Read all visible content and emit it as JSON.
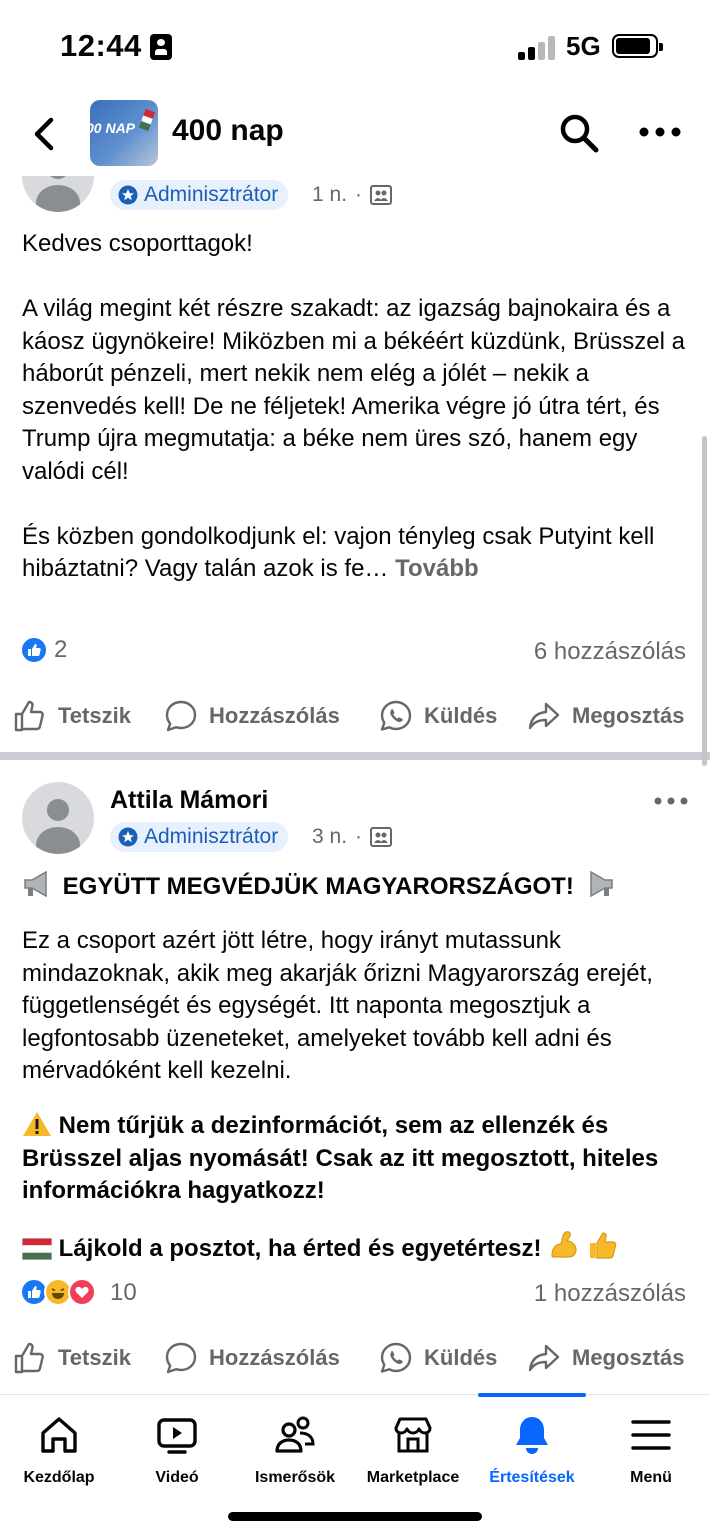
{
  "status_bar": {
    "time": "12:44",
    "network": "5G"
  },
  "header": {
    "group_name": "400 nap",
    "avatar_text": "00 NAP"
  },
  "post1": {
    "badge": "Adminisztrátor",
    "time": "1 n.",
    "dot": "·",
    "paragraphs": [
      "Kedves csoporttagok!",
      "A világ megint két részre szakadt: az igazság bajnokaira és a káosz ügynökeire! Miközben mi a békéért küzdünk, Brüsszel a háborút pénzeli, mert nekik nem elég a jólét – nekik a szenvedés kell! De ne féljetek! Amerika végre jó útra tért, és Trump újra megmutatja: a béke nem üres szó, hanem egy valódi cél!",
      "És közben gondolkodjunk el: vajon tényleg csak Putyint kell hibáztatni? Vagy talán azok is fe…"
    ],
    "more_label": "Tovább",
    "reaction_count": "2",
    "comment_count": "6 hozzászólás"
  },
  "post2": {
    "author": "Attila Mámori",
    "badge": "Adminisztrátor",
    "time": "3 n.",
    "dot": "·",
    "headline": "EGYÜTT MEGVÉDJÜK MAGYARORSZÁGOT!",
    "body": "Ez a csoport azért jött létre, hogy irányt mutassunk mindazoknak, akik meg akarják őrizni Magyarország erejét, függetlenségét és egységét. Itt naponta megosztjuk a legfontosabb üzeneteket, amelyeket tovább kell adni és mérvadóként kell kezelni.",
    "warning": "Nem tűrjük a dezinformációt, sem az ellenzék és Brüsszel aljas nyomását! Csak az itt megosztott, hiteles információkra hagyatkozz!",
    "cta": "Lájkold a posztot, ha érted és egyetértesz!",
    "reaction_count": "10",
    "comment_count": "1 hozzászólás"
  },
  "actions": {
    "like": "Tetszik",
    "comment": "Hozzászólás",
    "send": "Küldés",
    "share": "Megosztás"
  },
  "tabbar": {
    "items": [
      {
        "label": "Kezdőlap",
        "icon": "home-icon"
      },
      {
        "label": "Videó",
        "icon": "video-icon"
      },
      {
        "label": "Ismerősök",
        "icon": "friends-icon"
      },
      {
        "label": "Marketplace",
        "icon": "marketplace-icon"
      },
      {
        "label": "Értesítések",
        "icon": "bell-icon",
        "active": true
      },
      {
        "label": "Menü",
        "icon": "menu-icon"
      }
    ]
  },
  "colors": {
    "accent": "#0866ff",
    "badge_bg": "#e7f0fd",
    "badge_text": "#1b5fb5",
    "muted": "#65676b"
  }
}
